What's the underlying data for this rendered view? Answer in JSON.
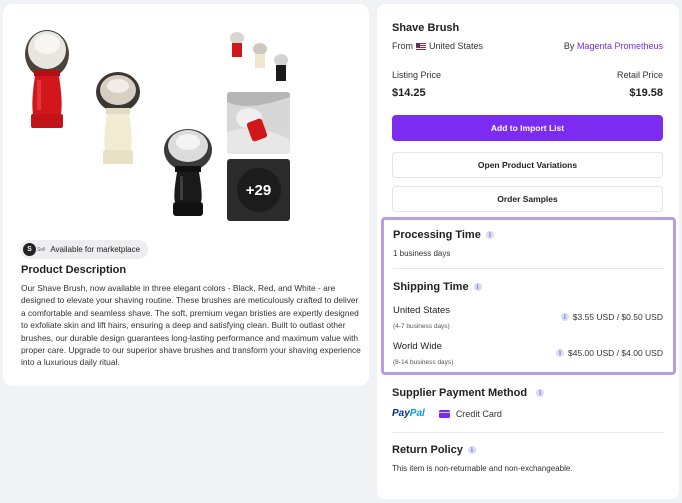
{
  "product": {
    "badge": "Available for marketplace",
    "badge_logo": "S",
    "badge_logo_text": "Sell",
    "more_images": "+29",
    "description_title": "Product Description",
    "description": "Our Shave Brush, now available in three elegant colors - Black, Red, and White - are designed to elevate your shaving routine. These brushes are meticulously crafted to deliver a comfortable and seamless shave. The soft, premium vegan bristies are expertly designed to exfoliate skin and lift hairs, ensuring a deep and satisfying clean. Built to outlast other brushes, our durable design guarantees long-lasting performance and maximum value with proper care. Upgrade to our superior shave brushes and transform your shaving experience into a luxurious daily ritual."
  },
  "details": {
    "title": "Shave Brush",
    "from_label": "From",
    "country": "United States",
    "by_label": "By",
    "supplier": "Magenta Prometheus",
    "listing_price_label": "Listing Price",
    "listing_price": "$14.25",
    "retail_price_label": "Retail Price",
    "retail_price": "$19.58",
    "add_button": "Add to Import List",
    "variations_button": "Open Product Variations",
    "samples_button": "Order Samples"
  },
  "processing": {
    "title": "Processing Time",
    "value": "1 business days"
  },
  "shipping": {
    "title": "Shipping Time",
    "rows": [
      {
        "destination": "United States",
        "time": "(4-7 business days)",
        "rate": "$3.55 USD / $0.50 USD"
      },
      {
        "destination": "World Wide",
        "time": "(8-14 business days)",
        "rate": "$45.00 USD / $4.00 USD"
      }
    ]
  },
  "payment": {
    "title": "Supplier Payment Method",
    "paypal_1": "Pay",
    "paypal_2": "Pal",
    "card": "Credit Card"
  },
  "returns": {
    "title": "Return Policy",
    "text": "This item is non-returnable and non-exchangeable."
  },
  "colors": {
    "accent": "#7b2cf0",
    "highlight_border": "#b89fe0",
    "supplier_link": "#7d2ae8"
  }
}
